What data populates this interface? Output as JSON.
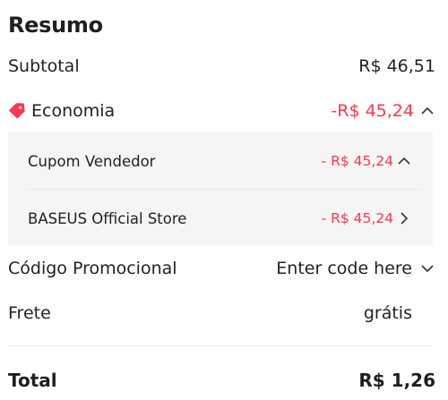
{
  "summary": {
    "title": "Resumo",
    "subtotal_label": "Subtotal",
    "subtotal_value": "R$ 46,51",
    "savings_label": "Economia",
    "savings_value": "-R$ 45,24",
    "savings_breakdown": [
      {
        "label": "Cupom Vendedor",
        "value": "- R$ 45,24",
        "icon": "chevron-up-icon"
      },
      {
        "label": "BASEUS Official Store",
        "value": "- R$ 45,24",
        "icon": "chevron-right-icon"
      }
    ],
    "promo_label": "Código Promocional",
    "promo_placeholder": "Enter code here",
    "shipping_label": "Frete",
    "shipping_value": "grátis",
    "total_label": "Total",
    "total_value": "R$ 1,26"
  },
  "colors": {
    "accent": "#fd384f",
    "panel_bg": "#f5f5f5"
  },
  "icons": {
    "savings": "tag-icon",
    "savings_toggle": "chevron-up-icon",
    "promo_toggle": "chevron-down-icon"
  }
}
